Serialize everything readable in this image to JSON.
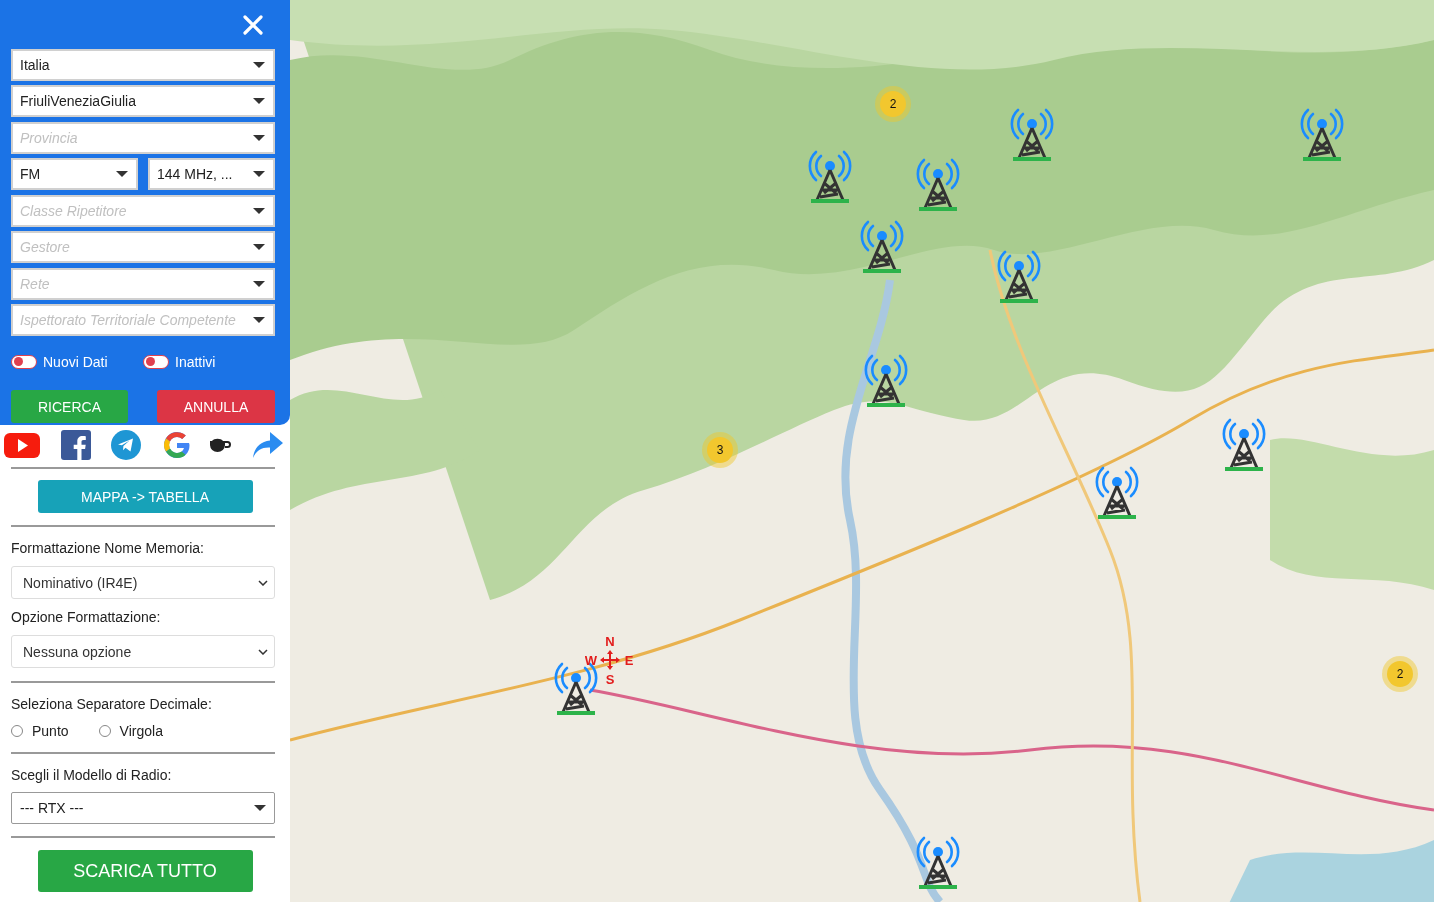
{
  "filter_rows": [
    [
      {
        "value": "Italia"
      }
    ],
    [
      {
        "value": "FriuliVeneziaGiulia"
      }
    ],
    [
      {
        "placeholder": "Provincia"
      }
    ],
    [
      {
        "value": "FM"
      },
      {
        "value": "144 MHz, ..."
      }
    ],
    [
      {
        "placeholder": "Classe Ripetitore"
      }
    ],
    [
      {
        "placeholder": "Gestore"
      }
    ],
    [
      {
        "placeholder": "Rete"
      }
    ],
    [
      {
        "placeholder": "Ispettorato Territoriale Competente"
      }
    ]
  ],
  "toggles": [
    {
      "label": "Nuovi Dati",
      "on": false
    },
    {
      "label": "Inattivi",
      "on": false
    }
  ],
  "search_button": "RICERCA",
  "cancel_button": "ANNULLA",
  "social": [
    {
      "kind": "youtube"
    },
    {
      "kind": "facebook"
    },
    {
      "kind": "telegram"
    },
    {
      "kind": "google"
    },
    {
      "kind": "coffee"
    },
    {
      "kind": "share"
    }
  ],
  "view_button": "MAPPA -> TABELLA",
  "memory_format": {
    "label": "Formattazione Nome Memoria:",
    "value": "Nominativo (IR4E)"
  },
  "format_option": {
    "label": "Opzione Formattazione:",
    "value": "Nessuna opzione"
  },
  "decimal_separator": {
    "label": "Seleziona Separatore Decimale:",
    "options": [
      {
        "label": "Punto",
        "selected": false
      },
      {
        "label": "Virgola",
        "selected": false
      }
    ]
  },
  "radio_model": {
    "label": "Scegli il Modello di Radio:",
    "value": "--- RTX ---"
  },
  "download_button": "SCARICA TUTTO",
  "map": {
    "kind": "picture",
    "markers": [
      {
        "kind": "tower"
      },
      {
        "kind": "tower"
      },
      {
        "kind": "tower"
      },
      {
        "kind": "tower"
      },
      {
        "kind": "tower"
      },
      {
        "kind": "tower"
      },
      {
        "kind": "tower"
      },
      {
        "kind": "tower"
      },
      {
        "kind": "tower"
      },
      {
        "kind": "tower"
      },
      {
        "kind": "tower"
      },
      {
        "kind": "cluster",
        "count": "2"
      },
      {
        "kind": "cluster",
        "count": "3"
      },
      {
        "kind": "cluster",
        "count": "2"
      }
    ],
    "compass": {
      "north": "N",
      "west": "W",
      "east": "E",
      "south": "S"
    }
  }
}
